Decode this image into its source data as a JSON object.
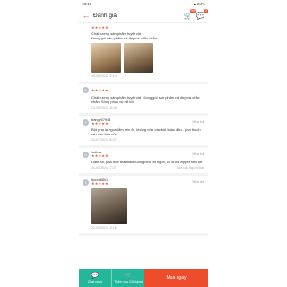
{
  "statusbar": {
    "time": "13:13",
    "battery": "24%"
  },
  "header": {
    "title": "Đánh giá",
    "cart_count": "99",
    "chat_count": "2"
  },
  "reviews": [
    {
      "text": "Chất lượng sản phẩm tuyệt vời\nĐóng gói sản phẩm rất đẹp và chắc chắn",
      "date": "09-08-2022 22:14",
      "stars": "★★★★★",
      "has_photos": true
    },
    {
      "user": "",
      "text": "Chất lượng sản phẩm tuyệt vời. Đóng gói sản phẩm rất đẹp và chắc chắn. Shop phục vụ rất tốt",
      "date": "13-05-2021 18:48",
      "stars": "★★★★★"
    },
    {
      "user": "trang007944",
      "text": "Bột pha la ngon lắm min ở.. không như các bột khác đâu.. pha thạch rau câu béo nữa",
      "date": "16-07-2021 06:57",
      "stars": "★★★★★",
      "like": "Hữu ích"
    },
    {
      "user": "hathsa",
      "text": "Date xa, pha trọe tearmalle uống béo rất ngon, có khóa zipper tiện lợi",
      "date": "20-05-2021 17:27",
      "stars": "★★★★★",
      "like": "Hữu ích",
      "report": "Báo cáo Người Bán"
    },
    {
      "user": "lipcon68k1",
      "text": "",
      "date": "22-03-2021 19:18",
      "stars": "★★★★★",
      "like": "Hữu ích"
    }
  ],
  "bottom": {
    "chat_label": "Chat ngay",
    "cart_label": "Thêm vào Giỏ hàng",
    "buy_label": "Mua ngay"
  },
  "colors": {
    "accent": "#ee4d2d",
    "teal": "#25b79a"
  }
}
